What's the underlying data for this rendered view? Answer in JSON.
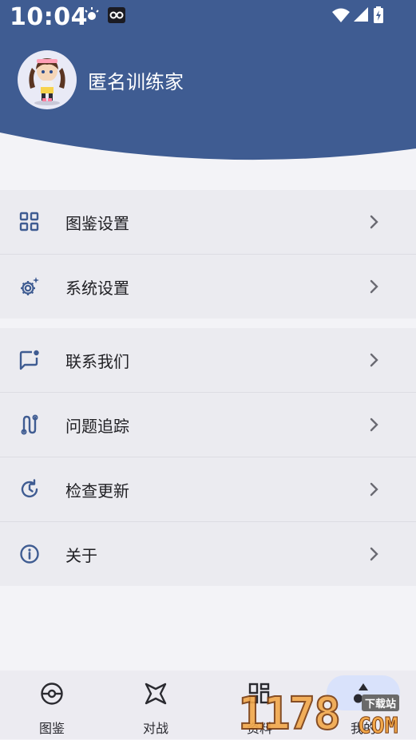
{
  "status_bar": {
    "time": "10:04"
  },
  "profile": {
    "name": "匿名训练家",
    "avatar": "trainer-avatar"
  },
  "theme": {
    "header_color": "#3f5c92",
    "icon_color": "#3f5c92",
    "nav_active_bg": "#d9e2fb"
  },
  "menu_group_1": [
    {
      "label": "图鉴设置",
      "icon": "grid-icon"
    },
    {
      "label": "系统设置",
      "icon": "gear-sparkle-icon"
    }
  ],
  "menu_group_2": [
    {
      "label": "联系我们",
      "icon": "chat-bubble-icon"
    },
    {
      "label": "问题追踪",
      "icon": "route-icon"
    },
    {
      "label": "检查更新",
      "icon": "history-icon"
    },
    {
      "label": "关于",
      "icon": "info-icon"
    }
  ],
  "bottom_nav": [
    {
      "label": "图鉴",
      "icon": "pokeball-icon",
      "active": false
    },
    {
      "label": "对战",
      "icon": "star-icon",
      "active": false
    },
    {
      "label": "资料",
      "icon": "dashboard-icon",
      "active": false
    },
    {
      "label": "我的",
      "icon": "shapes-icon",
      "active": true
    }
  ],
  "watermark": {
    "text": "1178",
    "tag": "下载站",
    "suffix": "COM"
  }
}
